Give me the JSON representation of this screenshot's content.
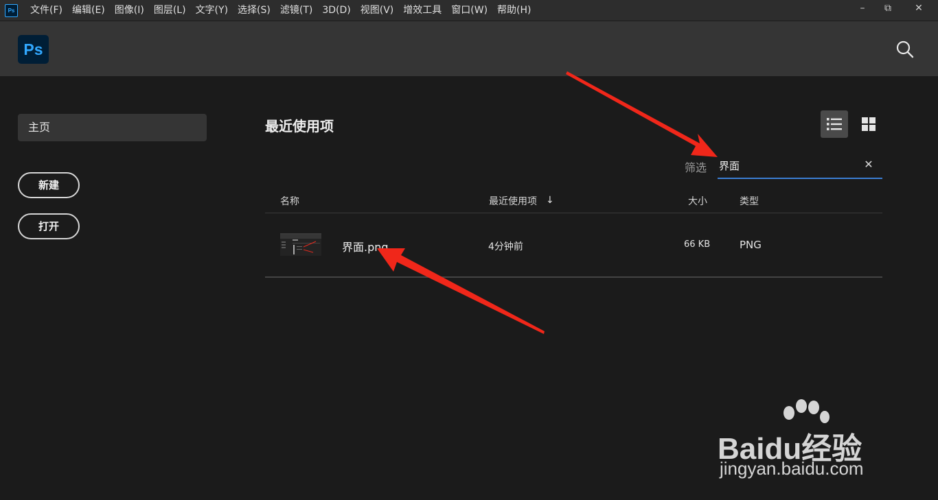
{
  "app": {
    "icon_label": "Ps",
    "logo_label": "Ps"
  },
  "menu": [
    "文件(F)",
    "编辑(E)",
    "图像(I)",
    "图层(L)",
    "文字(Y)",
    "选择(S)",
    "滤镜(T)",
    "3D(D)",
    "视图(V)",
    "增效工具",
    "窗口(W)",
    "帮助(H)"
  ],
  "window_controls": {
    "minimize": "–",
    "restore": "⧉",
    "close": "✕"
  },
  "sidebar": {
    "home": "主页",
    "new": "新建",
    "open": "打开"
  },
  "main": {
    "title": "最近使用项",
    "filter": {
      "label": "筛选",
      "value": "界面",
      "clear": "✕"
    },
    "columns": {
      "name": "名称",
      "recent": "最近使用项",
      "size": "大小",
      "type": "类型",
      "sort_indicator": "↓"
    },
    "files": [
      {
        "name": "界面.png",
        "recent": "4分钟前",
        "size": "66 KB",
        "type": "PNG"
      }
    ]
  },
  "annotations": {
    "arrow_color": "#f0271a"
  },
  "watermark": {
    "main": "Baidu经验",
    "sub": "jingyan.baidu.com"
  },
  "colors": {
    "background": "#1b1b1b",
    "header": "#353535",
    "menubar": "#2d2d2d",
    "accent": "#31a8ff",
    "focus_underline": "#3b7fd4"
  }
}
